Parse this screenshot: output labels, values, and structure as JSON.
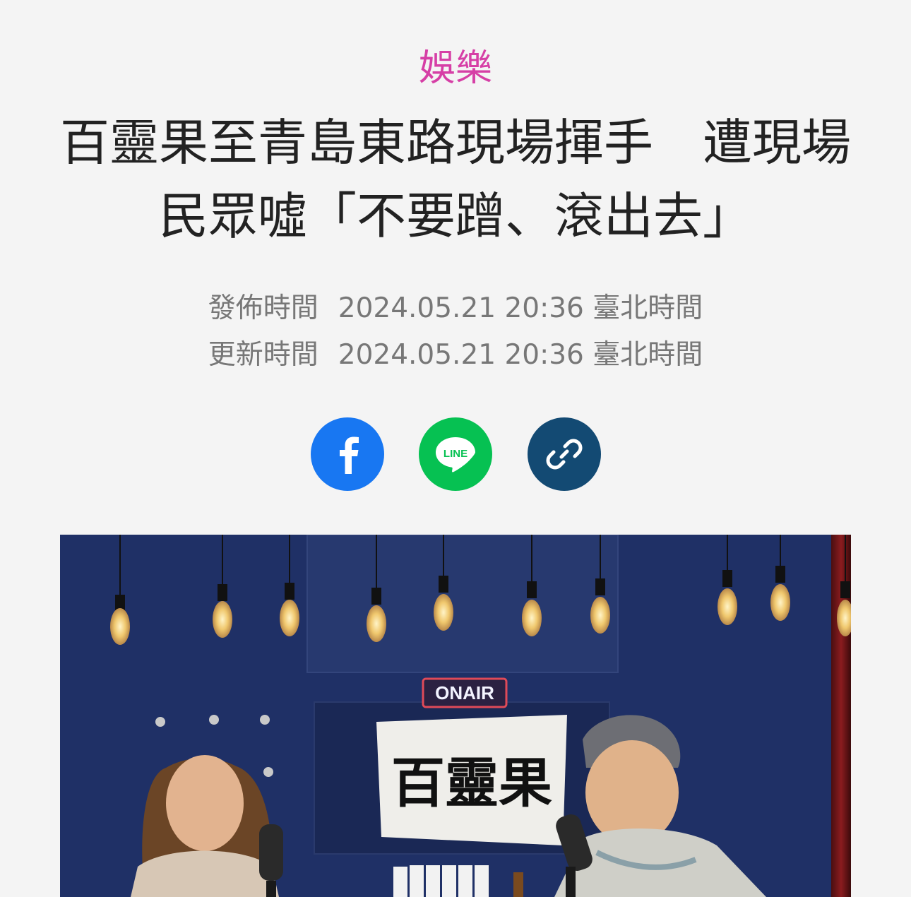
{
  "article": {
    "category": "娛樂",
    "headline_line1": "百靈果至青島東路現場揮手　遭現場",
    "headline_line2": "民眾噓「不要蹭、滾出去」",
    "published_label": "發佈時間",
    "published_value": "2024.05.21 20:36 臺北時間",
    "updated_label": "更新時間",
    "updated_value": "2024.05.21 20:36 臺北時間"
  },
  "share": {
    "facebook_icon": "facebook-icon",
    "line_icon": "line-icon",
    "line_text": "LINE",
    "copy_link_icon": "link-icon"
  },
  "photo": {
    "onair_sign": "ONAIR",
    "banner_text": "百靈果"
  },
  "colors": {
    "category": "#d63fa6",
    "facebook": "#1877f2",
    "line": "#06c152",
    "link": "#134a73",
    "background": "#f4f4f4"
  }
}
